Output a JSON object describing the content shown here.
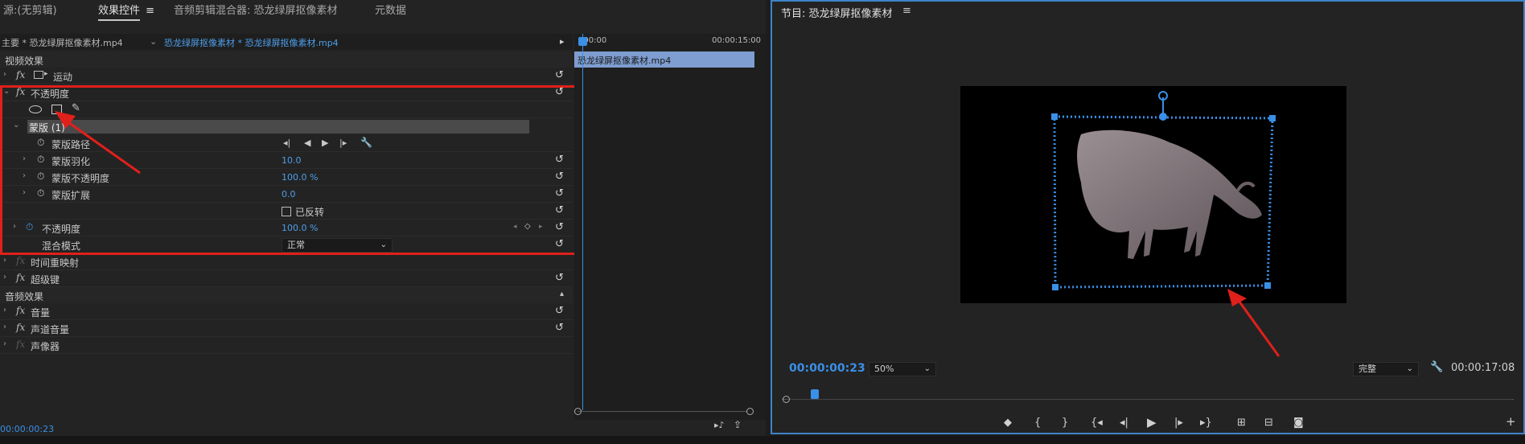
{
  "left_panel": {
    "tabs": [
      {
        "label": "源:(无剪辑)"
      },
      {
        "label": "效果控件"
      },
      {
        "label": "音频剪辑混合器: 恐龙绿屏抠像素材"
      },
      {
        "label": "元数据"
      }
    ],
    "clip_row": {
      "master": "主要 * 恐龙绿屏抠像素材.mp4",
      "sequence": "恐龙绿屏抠像素材 * 恐龙绿屏抠像素材.mp4"
    },
    "timeline": {
      "start": ":00:00",
      "end": "00:00:15:00",
      "clip_name": "恐龙绿屏抠像素材.mp4"
    },
    "sections": {
      "video": "视频效果",
      "audio": "音频效果"
    },
    "rows": {
      "motion": "运动",
      "opacity": "不透明度",
      "mask": "蒙版 (1)",
      "mask_path": "蒙版路径",
      "mask_feather": "蒙版羽化",
      "mask_feather_value": "10.0",
      "mask_opacity": "蒙版不透明度",
      "mask_opacity_value": "100.0 %",
      "mask_expansion": "蒙版扩展",
      "mask_expansion_value": "0.0",
      "inverted": "已反转",
      "opacity_prop": "不透明度",
      "opacity_value": "100.0 %",
      "blend_mode": "混合模式",
      "blend_value": "正常",
      "time_remap": "时间重映射",
      "ultra_key": "超级键",
      "volume": "音量",
      "channel_volume": "声道音量",
      "panner": "声像器"
    },
    "timecode": "00:00:00:23"
  },
  "program_monitor": {
    "title": "节目: 恐龙绿屏抠像素材",
    "timecode": "00:00:00:23",
    "zoom": "50%",
    "quality": "完整",
    "duration": "00:00:17:08"
  },
  "colors": {
    "accent_blue": "#3a8fe6",
    "highlight_red": "#e0201b",
    "panel_bg": "#232323"
  },
  "icons": [
    "ellipse-mask-icon",
    "rectangle-mask-icon",
    "pen-mask-icon",
    "stopwatch-icon",
    "reset-icon",
    "wrench-icon",
    "play-icon",
    "step-back-icon",
    "step-forward-icon",
    "marker-icon",
    "camera-icon",
    "plus-icon"
  ]
}
